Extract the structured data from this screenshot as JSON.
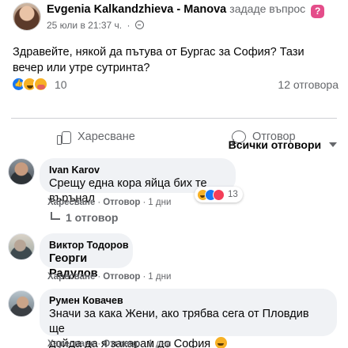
{
  "post": {
    "author": "Evgenia Kalkandzhieva - Manova",
    "post_type": "зададе въпрос",
    "badge": "?",
    "date": "25 юли в 21:37 ч.",
    "text": "Здравейте, някой да пътува от Бургас за София? Тази вечер или утре сутринта?",
    "reactions_count": "10",
    "answers_count": "12 отговора",
    "reaction_icons": [
      "like-icon",
      "haha-icon",
      "care-icon"
    ]
  },
  "actions": {
    "like": "Харесване",
    "reply": "Отговор"
  },
  "sort": {
    "label": "Всички отговори"
  },
  "comments": [
    {
      "author": "Ivan Karov",
      "text": "Срещу една кора яйца бих те върънал",
      "like": "Харесване",
      "reply": "Отговор",
      "time": "1 дни",
      "reactions_count": "13",
      "replies": "1 отговор"
    },
    {
      "author": "Виктор Тодоров",
      "text": "Георги Радулов",
      "like": "Харесване",
      "reply": "Отговор",
      "time": "1 дни"
    },
    {
      "author": "Румен Ковачев",
      "text_line1": "Значи за кака Жени, ако трябва сега от Пловдив ще",
      "text_line2": "дойда да я закарам до София",
      "like": "Харесване",
      "reply": "Отговор",
      "time": "1 дни"
    }
  ],
  "colors": {
    "text": "#050505",
    "secondary": "#65676b",
    "bubble": "#f0f2f5",
    "accent": "#1877f2",
    "badge": "#e44d8a"
  }
}
